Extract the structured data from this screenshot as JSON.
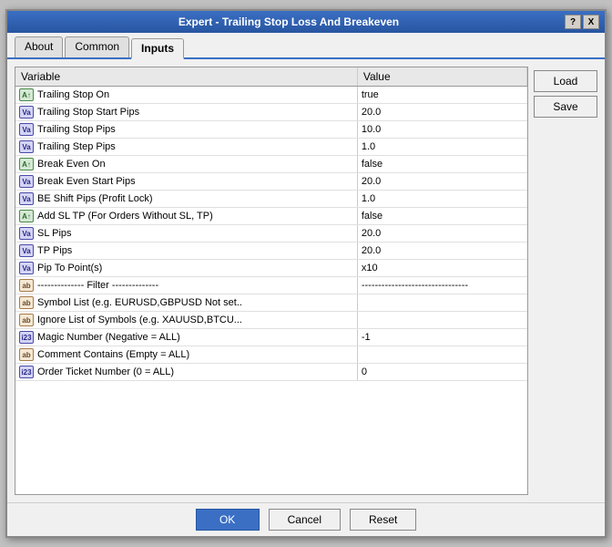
{
  "window": {
    "title": "Expert - Trailing Stop Loss And Breakeven",
    "help_btn": "?",
    "close_btn": "X"
  },
  "tabs": [
    {
      "id": "about",
      "label": "About",
      "active": false
    },
    {
      "id": "common",
      "label": "Common",
      "active": false
    },
    {
      "id": "inputs",
      "label": "Inputs",
      "active": true
    }
  ],
  "table": {
    "col_variable": "Variable",
    "col_value": "Value",
    "rows": [
      {
        "icon_type": "bool",
        "icon_label": "A↑",
        "variable": "Trailing Stop On",
        "value": "true"
      },
      {
        "icon_type": "num",
        "icon_label": "Va",
        "variable": "Trailing Stop Start Pips",
        "value": "20.0"
      },
      {
        "icon_type": "num",
        "icon_label": "Va",
        "variable": "Trailing Stop Pips",
        "value": "10.0"
      },
      {
        "icon_type": "num",
        "icon_label": "Va",
        "variable": "Trailing Step Pips",
        "value": "1.0"
      },
      {
        "icon_type": "bool",
        "icon_label": "A↑",
        "variable": "Break Even On",
        "value": "false"
      },
      {
        "icon_type": "num",
        "icon_label": "Va",
        "variable": "Break Even Start Pips",
        "value": "20.0"
      },
      {
        "icon_type": "num",
        "icon_label": "Va",
        "variable": "BE Shift Pips (Profit Lock)",
        "value": "1.0"
      },
      {
        "icon_type": "bool",
        "icon_label": "A↑",
        "variable": "Add SL TP (For Orders Without SL, TP)",
        "value": "false"
      },
      {
        "icon_type": "num",
        "icon_label": "Va",
        "variable": "SL Pips",
        "value": "20.0"
      },
      {
        "icon_type": "num",
        "icon_label": "Va",
        "variable": "TP Pips",
        "value": "20.0"
      },
      {
        "icon_type": "num",
        "icon_label": "Va",
        "variable": "Pip To Point(s)",
        "value": "x10"
      },
      {
        "icon_type": "filter",
        "icon_label": "ab",
        "variable": "-------------- Filter --------------",
        "value": "--------------------------------"
      },
      {
        "icon_type": "str",
        "icon_label": "ab",
        "variable": "Symbol List (e.g. EURUSD,GBPUSD Not set..",
        "value": ""
      },
      {
        "icon_type": "str",
        "icon_label": "ab",
        "variable": "Ignore List of Symbols (e.g. XAUUSD,BTCU...",
        "value": ""
      },
      {
        "icon_type": "num",
        "icon_label": "i23",
        "variable": "Magic Number (Negative = ALL)",
        "value": "-1"
      },
      {
        "icon_type": "str",
        "icon_label": "ab",
        "variable": "Comment Contains (Empty = ALL)",
        "value": ""
      },
      {
        "icon_type": "num",
        "icon_label": "i23",
        "variable": "Order Ticket Number (0 = ALL)",
        "value": "0"
      }
    ]
  },
  "buttons": {
    "load": "Load",
    "save": "Save",
    "ok": "OK",
    "cancel": "Cancel",
    "reset": "Reset"
  }
}
